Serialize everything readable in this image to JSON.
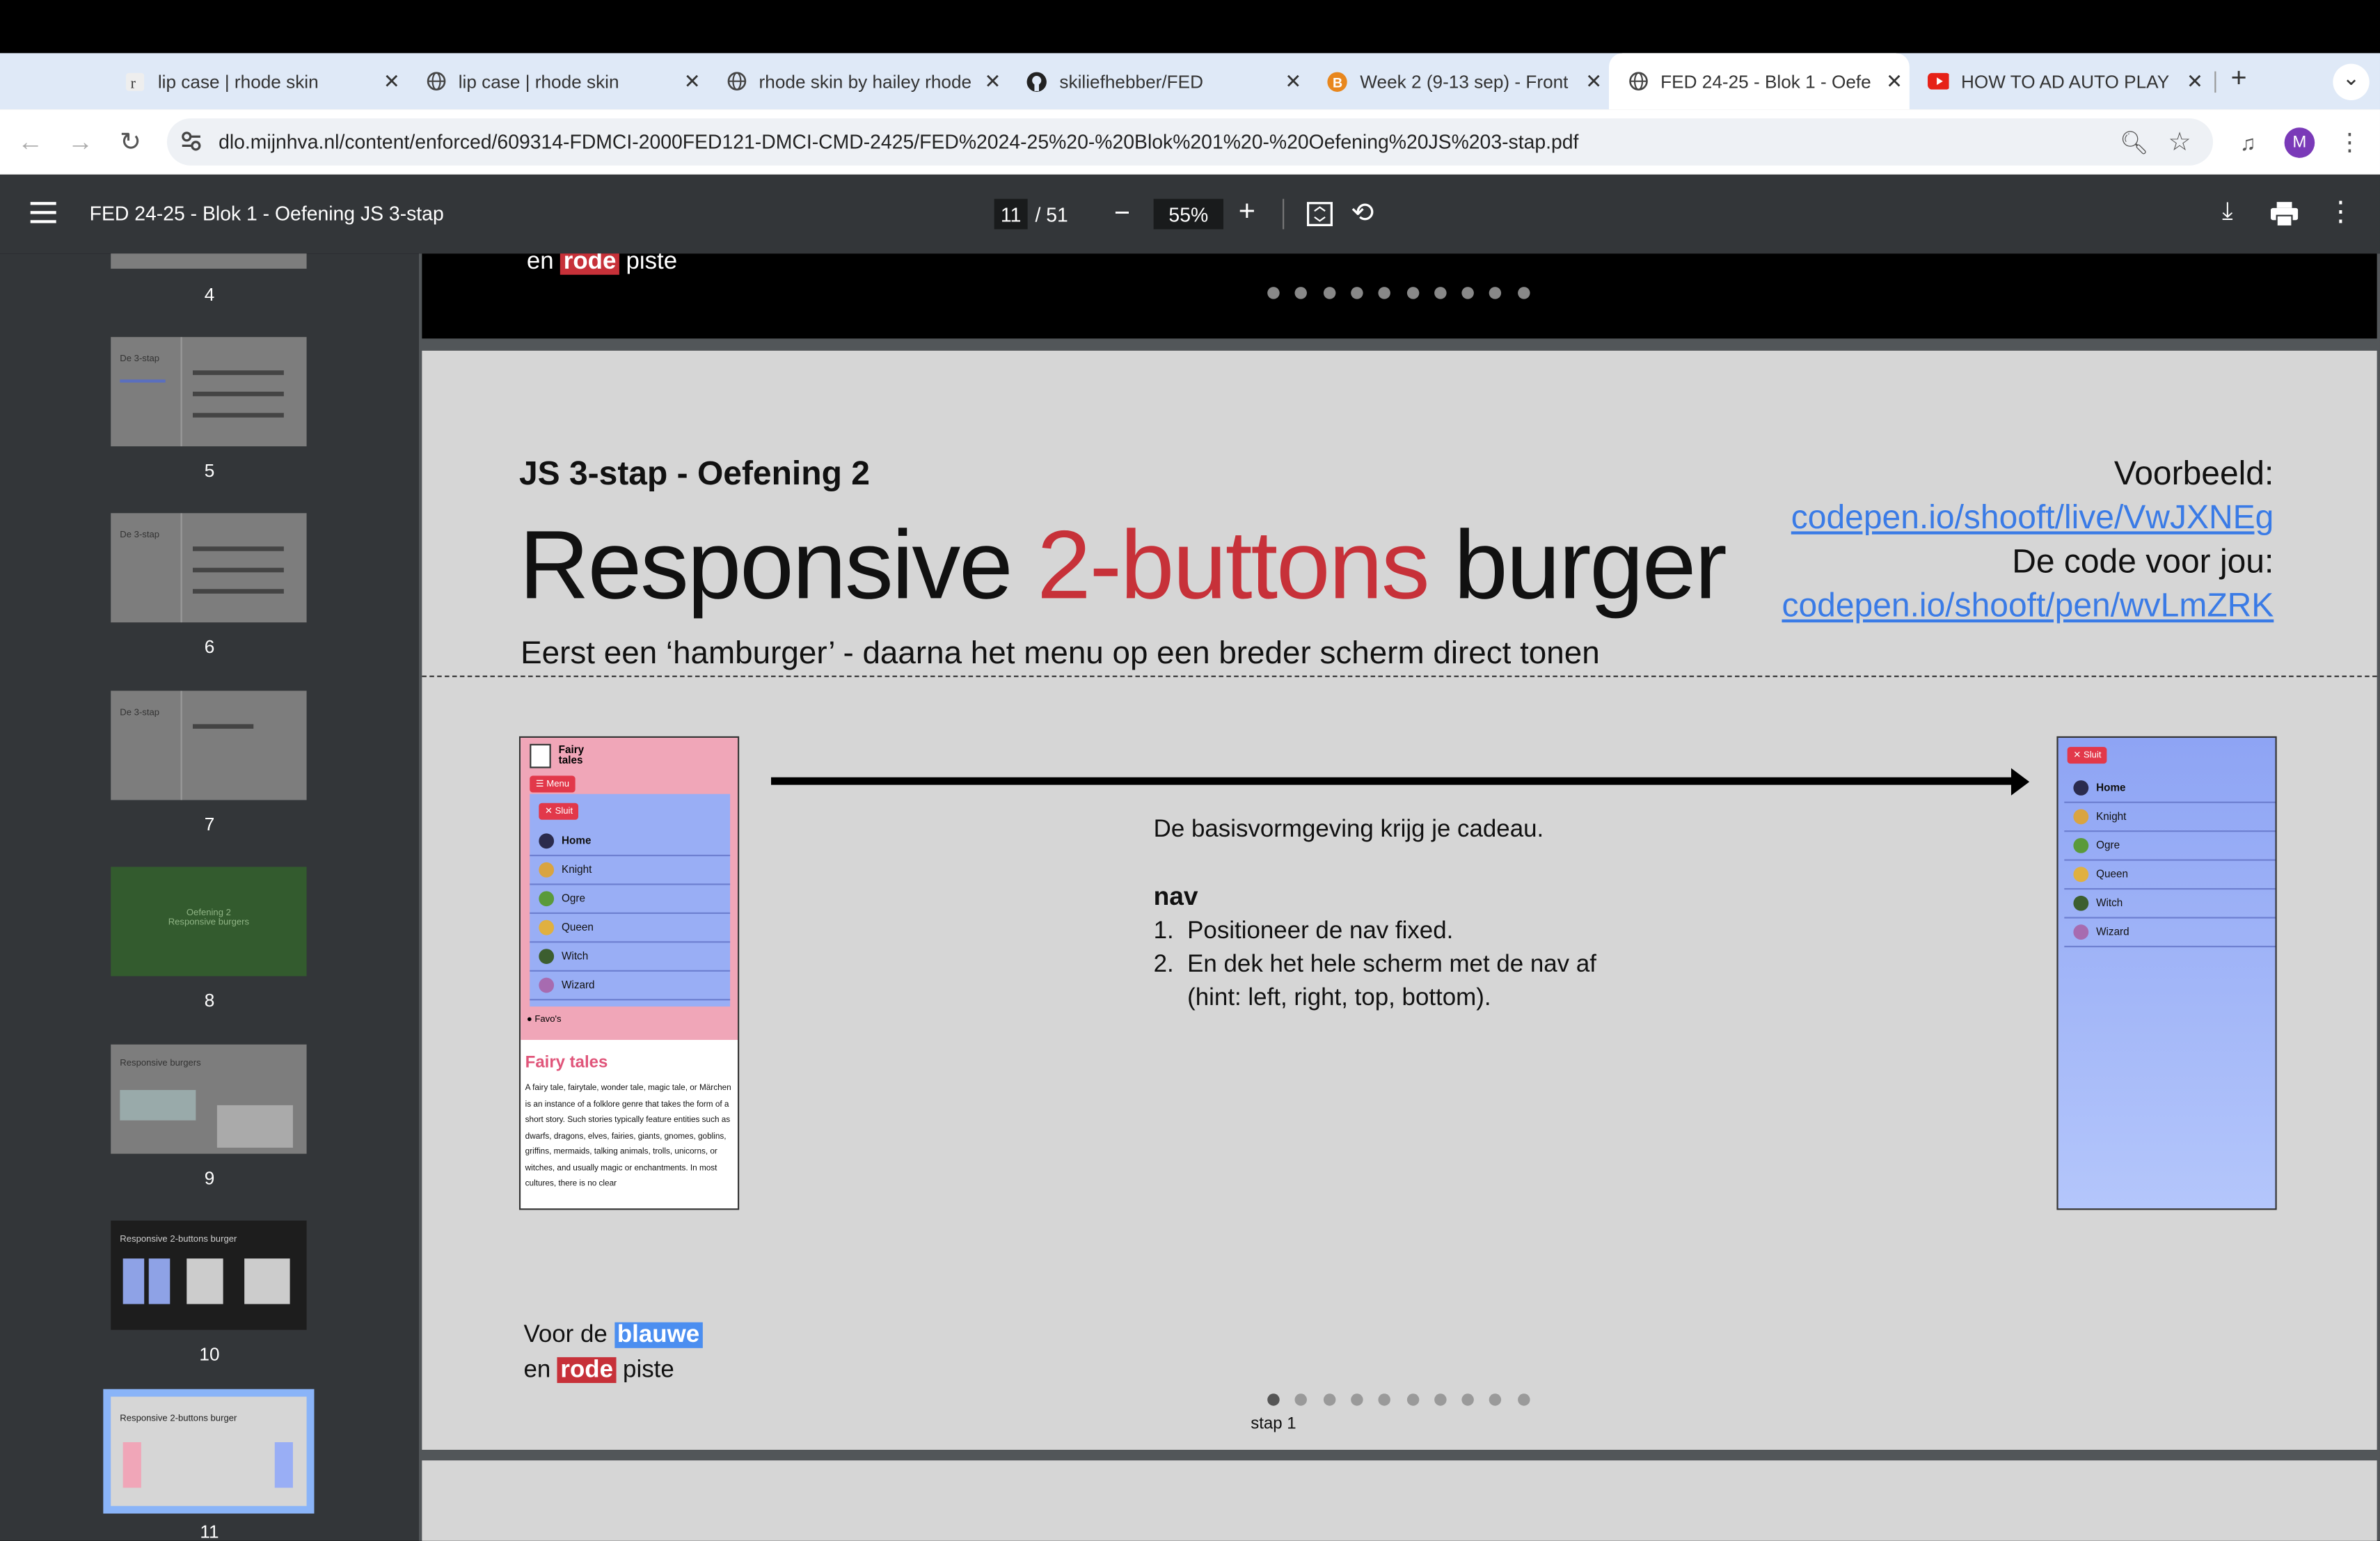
{
  "tabs": [
    {
      "title": "lip case | rhode skin",
      "icon": "rhode-favicon-icon",
      "active": false
    },
    {
      "title": "lip case | rhode skin",
      "icon": "globe-icon",
      "active": false
    },
    {
      "title": "rhode skin by hailey rhode",
      "icon": "globe-icon",
      "active": false
    },
    {
      "title": "skiliefhebber/FED",
      "icon": "github-icon",
      "active": false
    },
    {
      "title": "Week 2 (9-13 sep) - Front",
      "icon": "bitbucket-icon",
      "active": false
    },
    {
      "title": "FED 24-25 - Blok 1 - Oefe",
      "icon": "globe-icon",
      "active": true
    },
    {
      "title": "HOW TO AD AUTO PLAY",
      "icon": "youtube-icon",
      "active": false
    }
  ],
  "new_tab_label": "+",
  "tab_overflow_label": "⌄",
  "address": {
    "url": "dlo.mijnhva.nl/content/enforced/609314-FDMCI-2000FED121-DMCI-CMD-2425/FED%2024-25%20-%20Blok%201%20-%20Oefening%20JS%203-stap.pdf"
  },
  "profile_initial": "M",
  "pdf_toolbar": {
    "title": "FED 24-25 - Blok 1 - Oefening JS 3-stap",
    "current_page": "11",
    "page_total": "/ 51",
    "zoom": "55%"
  },
  "thumbnails": [
    {
      "num": "4"
    },
    {
      "num": "5",
      "label": "De 3-stap"
    },
    {
      "num": "6",
      "label": "De 3-stap"
    },
    {
      "num": "7",
      "label": "De 3-stap"
    },
    {
      "num": "8",
      "label": "Oefening 2\nResponsive burgers"
    },
    {
      "num": "9",
      "label": "Responsive burgers"
    },
    {
      "num": "10",
      "label": "Responsive 2-buttons burger"
    },
    {
      "num": "11",
      "label": "Responsive 2-buttons burger"
    }
  ],
  "prev_page_text": {
    "en": "en",
    "red": "rode",
    "piste": "piste"
  },
  "slide": {
    "kicker": "JS 3-stap - Oefening 2",
    "title_part1": "Responsive ",
    "title_part2": "2-buttons",
    "title_part3": " burger",
    "subtitle": "Eerst een ‘hamburger’ - daarna het menu op een breder scherm direct tonen",
    "voorbeeld_label": "Voorbeeld:",
    "voorbeeld_link": "codepen.io/shooft/live/VwJXNEg",
    "code_label": "De code voor jou:",
    "code_link": "codepen.io/shooft/pen/wvLmZRK",
    "intro": "De basisvormgeving krijg je cadeau.",
    "section": "nav",
    "steps": [
      "1.  Positioneer de nav fixed.",
      "2.  En dek het hele scherm met de nav af",
      "     (hint: left, right, top, bottom)."
    ],
    "footer_line1_pre": "Voor de ",
    "footer_blue": "blauwe",
    "footer_line2_pre": "en ",
    "footer_red": "rode",
    "footer_line2_post": " piste",
    "step_label": "stap 1"
  },
  "phone_small": {
    "brand": "Fairy tales",
    "menu_btn": "Menu",
    "close_btn": "Sluit",
    "items": [
      "Home",
      "Knight",
      "Ogre",
      "Queen",
      "Witch",
      "Wizard"
    ],
    "favs": "Favo's",
    "heading": "Fairy tales",
    "body": "A fairy tale, fairytale, wonder tale, magic tale, or Märchen is an instance of a folklore genre that takes the form of a short story. Such stories typically feature entities such as dwarfs, dragons, elves, fairies, giants, gnomes, goblins, griffins, mermaids, talking animals, trolls, unicorns, or witches, and usually magic or enchantments. In most cultures, there is no clear"
  },
  "phone_large": {
    "close_btn": "Sluit",
    "items": [
      "Home",
      "Knight",
      "Ogre",
      "Queen",
      "Witch",
      "Wizard"
    ]
  },
  "colors": {
    "accent_red": "#c73139",
    "link_blue": "#3a7be6",
    "nav_blue": "#99aef5",
    "pink": "#f0a6b8"
  }
}
